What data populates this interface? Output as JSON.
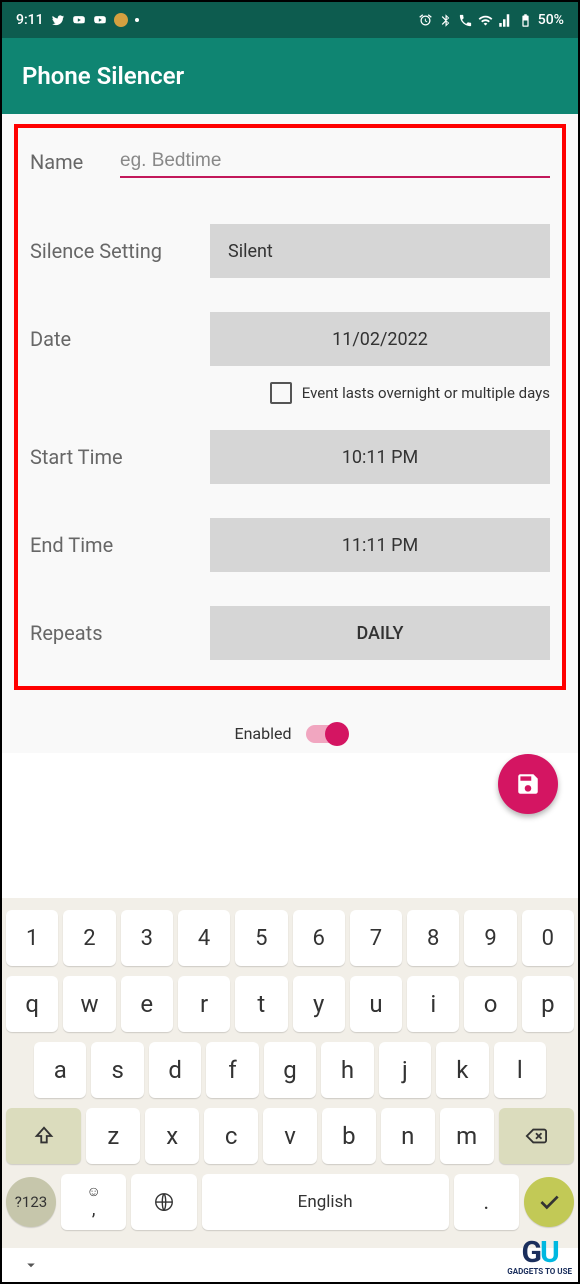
{
  "status": {
    "time": "9:11",
    "battery": "50%"
  },
  "app": {
    "title": "Phone Silencer"
  },
  "form": {
    "name_label": "Name",
    "name_placeholder": "eg. Bedtime",
    "silence_label": "Silence Setting",
    "silence_value": "Silent",
    "date_label": "Date",
    "date_value": "11/02/2022",
    "overnight_label": "Event lasts overnight or multiple days",
    "start_label": "Start Time",
    "start_value": "10:11 PM",
    "end_label": "End Time",
    "end_value": "11:11 PM",
    "repeats_label": "Repeats",
    "repeats_value": "DAILY",
    "enabled_label": "Enabled"
  },
  "keyboard": {
    "row1": [
      "1",
      "2",
      "3",
      "4",
      "5",
      "6",
      "7",
      "8",
      "9",
      "0"
    ],
    "row2": [
      "q",
      "w",
      "e",
      "r",
      "t",
      "y",
      "u",
      "i",
      "o",
      "p"
    ],
    "row3": [
      "a",
      "s",
      "d",
      "f",
      "g",
      "h",
      "j",
      "k",
      "l"
    ],
    "row4": [
      "z",
      "x",
      "c",
      "v",
      "b",
      "n",
      "m"
    ],
    "sym": "?123",
    "space": "English",
    "period": "."
  },
  "watermark": {
    "text": "GADGETS TO USE"
  }
}
